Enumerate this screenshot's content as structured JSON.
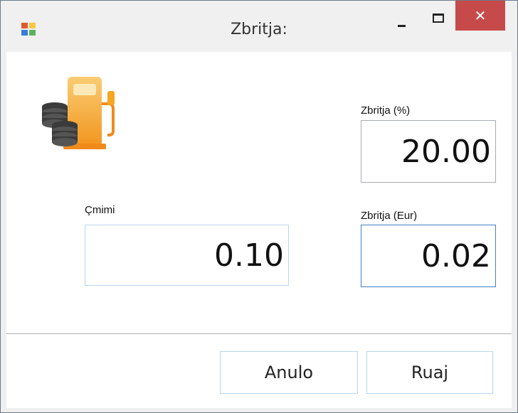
{
  "window": {
    "title": "Zbritja:",
    "close_glyph": "✕",
    "app_icon": "app-window-icon"
  },
  "form": {
    "icon": "fuel-coins-icon",
    "discount_pct": {
      "label": "Zbritja (%)",
      "value": "20.00"
    },
    "price": {
      "label": "Çmimi",
      "value": "0.10"
    },
    "discount_eur": {
      "label": "Zbritja (Eur)",
      "value": "0.02"
    }
  },
  "buttons": {
    "cancel": "Anulo",
    "save": "Ruaj"
  },
  "colors": {
    "close_button": "#c74a4a",
    "focus_border": "#3f82c8",
    "fuel_orange": "#f5a623"
  }
}
